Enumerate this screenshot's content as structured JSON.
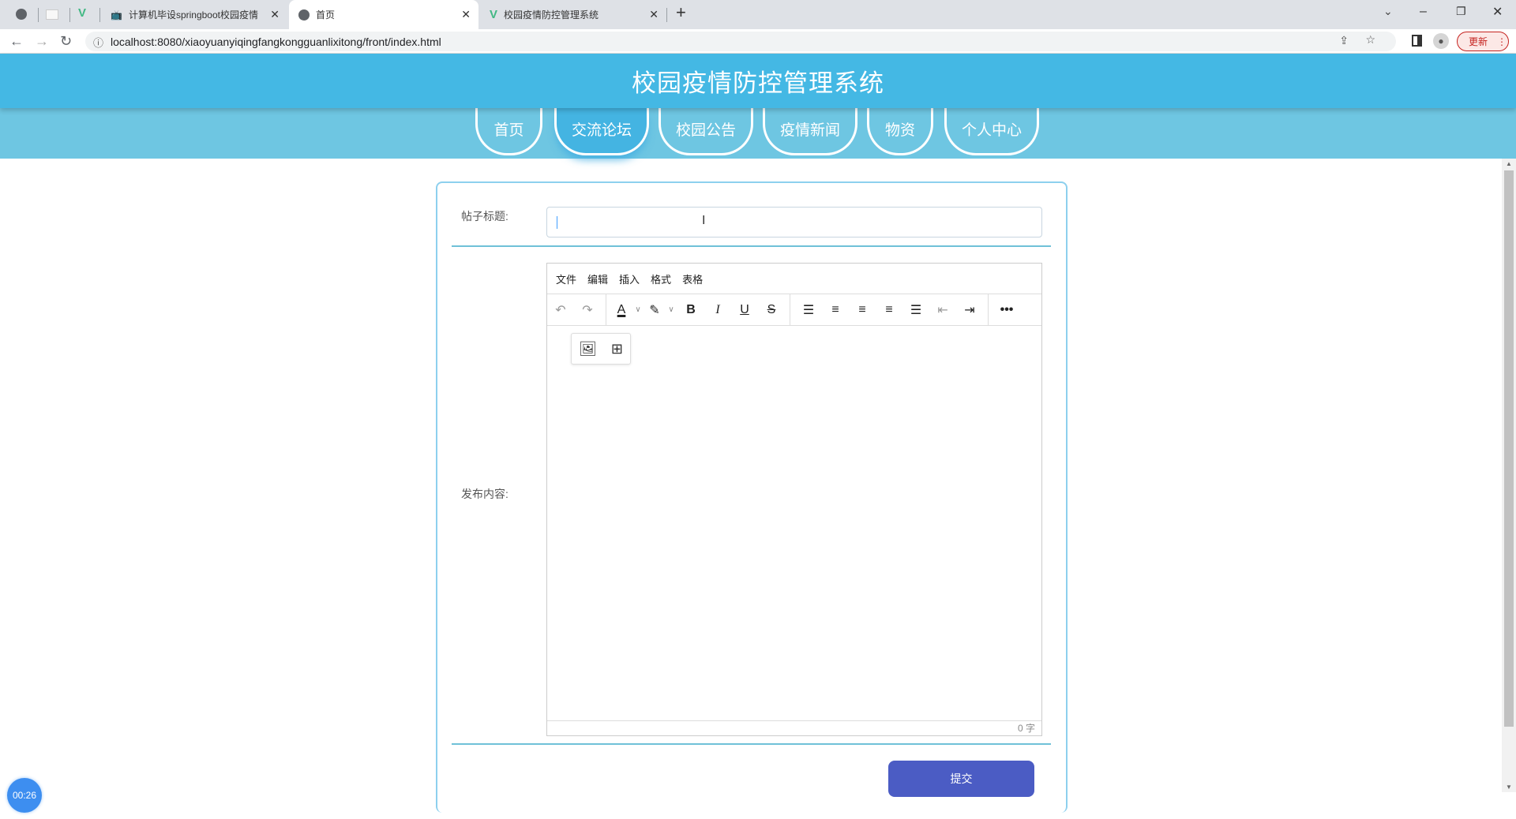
{
  "browser": {
    "tabs": [
      {
        "label": "计算机毕设springboot校园疫情"
      },
      {
        "label": "首页"
      },
      {
        "label": "校园疫情防控管理系统"
      }
    ],
    "new_tab": "+",
    "url": "localhost:8080/xiaoyuanyiqingfangkongguanlixitong/front/index.html",
    "update_label": "更新"
  },
  "header": {
    "title": "校园疫情防控管理系统"
  },
  "nav": [
    {
      "label": "首页"
    },
    {
      "label": "交流论坛",
      "active": true
    },
    {
      "label": "校园公告"
    },
    {
      "label": "疫情新闻"
    },
    {
      "label": "物资"
    },
    {
      "label": "个人中心"
    }
  ],
  "form": {
    "title_label": "帖子标题:",
    "title_value": "",
    "content_label": "发布内容:",
    "editor_menu": [
      "文件",
      "编辑",
      "插入",
      "格式",
      "表格"
    ],
    "word_count": "0 字",
    "submit_label": "提交"
  },
  "timer": "00:26"
}
